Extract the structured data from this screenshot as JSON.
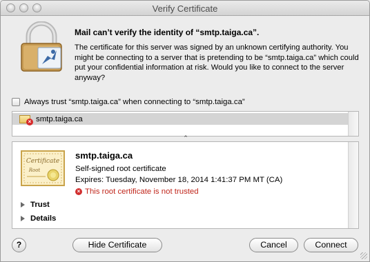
{
  "window": {
    "title": "Verify Certificate"
  },
  "dialog": {
    "heading": "Mail can’t verify the identity of “smtp.taiga.ca”.",
    "body": "The certificate for this server was signed by an unknown certifying authority. You might be connecting to a server that is pretending to be “smtp.taiga.ca” which could put your confidential information at risk. Would you like to connect to the server anyway?",
    "lock_icon": "padlock-certificate-icon"
  },
  "always_trust": {
    "label": "Always trust “smtp.taiga.ca” when connecting to “smtp.taiga.ca”",
    "checked": false
  },
  "chain": {
    "items": [
      {
        "label": "smtp.taiga.ca",
        "icon": "certificate-error-icon",
        "selected": true
      }
    ]
  },
  "certificate": {
    "name": "smtp.taiga.ca",
    "type": "Self-signed root certificate",
    "expires": "Expires: Tuesday, November 18, 2014 1:41:37 PM MT (CA)",
    "status": "This root certificate is not trusted",
    "image_text_1": "Certificate",
    "image_text_2": "Root",
    "status_color": "#c0261b"
  },
  "sections": {
    "trust": "Trust",
    "details": "Details"
  },
  "buttons": {
    "help": "?",
    "hide_certificate": "Hide Certificate",
    "cancel": "Cancel",
    "connect": "Connect"
  }
}
